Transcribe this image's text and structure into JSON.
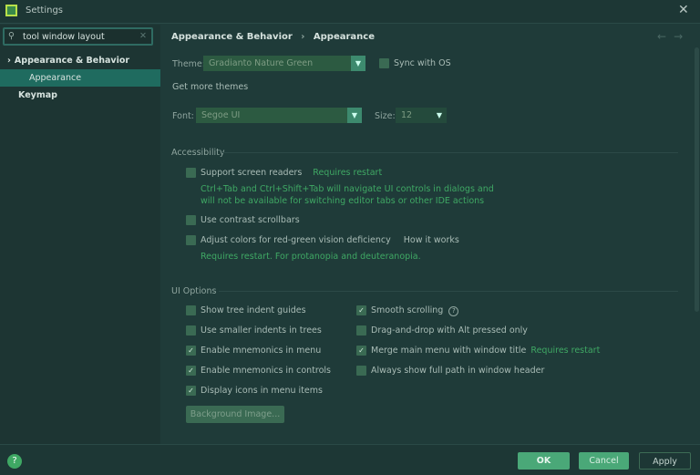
{
  "window": {
    "title": "Settings",
    "close": "✕"
  },
  "search": {
    "value": "tool window layout",
    "icon": "search-icon",
    "clear": "✕"
  },
  "sidebar": {
    "items": [
      {
        "label": "Appearance & Behavior",
        "expanded": true,
        "chevron": "⌄"
      },
      {
        "label": "Appearance",
        "selected": true
      },
      {
        "label": "Keymap"
      }
    ]
  },
  "breadcrumb": {
    "parent": "Appearance & Behavior",
    "sep": "›",
    "current": "Appearance",
    "back": "←",
    "forward": "→"
  },
  "theme": {
    "label": "Theme:",
    "value": "Gradianto Nature Green",
    "sync_label": "Sync with OS",
    "sync_checked": false,
    "get_more": "Get more themes"
  },
  "font": {
    "label": "Font:",
    "value": "Segoe UI",
    "size_label": "Size:",
    "size_value": "12"
  },
  "accessibility": {
    "title": "Accessibility",
    "screen_readers": {
      "label": "Support screen readers",
      "note": "Requires restart",
      "checked": false,
      "desc1": "Ctrl+Tab and Ctrl+Shift+Tab will navigate UI controls in dialogs and",
      "desc2": "will not be available for switching editor tabs or other IDE actions"
    },
    "contrast": {
      "label": "Use contrast scrollbars",
      "checked": false
    },
    "colors": {
      "label": "Adjust colors for red-green vision deficiency",
      "link": "How it works",
      "note": "Requires restart. For protanopia and deuteranopia.",
      "checked": false
    }
  },
  "ui_options": {
    "title": "UI Options",
    "left": [
      {
        "label": "Show tree indent guides",
        "checked": false
      },
      {
        "label": "Use smaller indents in trees",
        "checked": false
      },
      {
        "label": "Enable mnemonics in menu",
        "checked": true
      },
      {
        "label": "Enable mnemonics in controls",
        "checked": true
      },
      {
        "label": "Display icons in menu items",
        "checked": true
      }
    ],
    "right": [
      {
        "label": "Smooth scrolling",
        "checked": true,
        "help": "?"
      },
      {
        "label": "Drag-and-drop with Alt pressed only",
        "checked": false
      },
      {
        "label": "Merge main menu with window title",
        "checked": true,
        "note": "Requires restart"
      },
      {
        "label": "Always show full path in window header",
        "checked": false
      }
    ],
    "background_button": "Background Image..."
  },
  "footer": {
    "help": "?",
    "ok": "OK",
    "cancel": "Cancel",
    "apply": "Apply"
  },
  "colors": {
    "accent": "#3fa864",
    "selection": "#1f6b5f",
    "background": "#1f3b39"
  }
}
